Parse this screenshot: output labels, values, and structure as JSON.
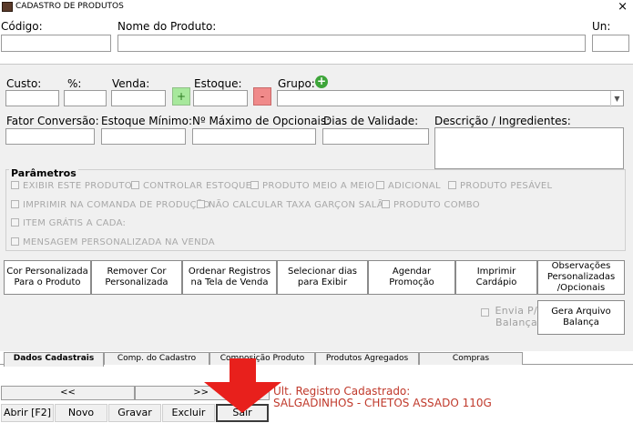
{
  "window": {
    "title": "CADASTRO DE PRODUTOS",
    "close_glyph": "×"
  },
  "top_fields": {
    "codigo_label": "Código:",
    "nome_label": "Nome do Produto:",
    "un_label": "Un:"
  },
  "row1": {
    "custo_label": "Custo:",
    "pct_label": "%:",
    "venda_label": "Venda:",
    "plus_glyph": "+",
    "estoque_label": "Estoque:",
    "minus_glyph": "-",
    "grupo_label": "Grupo:",
    "grupo_add_glyph": "+"
  },
  "row2": {
    "fator_label": "Fator Conversão:",
    "estoque_min_label": "Estoque Mínimo:",
    "max_opc_label": "Nº Máximo de Opcionais:",
    "validade_label": "Dias de Validade:",
    "descricao_label": "Descrição / Ingredientes:"
  },
  "parametros": {
    "title": "Parâmetros",
    "row1": [
      "EXIBIR ESTE PRODUTO",
      "CONTROLAR ESTOQUE",
      "PRODUTO MEIO A MEIO",
      "ADICIONAL",
      "PRODUTO PESÁVEL"
    ],
    "row2": [
      "IMPRIMIR NA COMANDA DE PRODUÇÃO",
      "NÃO CALCULAR TAXA GARÇON SALÃO",
      "PRODUTO COMBO"
    ],
    "row3": "ITEM GRÁTIS A CADA:",
    "row4": "MENSAGEM PERSONALIZADA NA VENDA"
  },
  "actions": {
    "cor_personalizada": "Cor Personalizada Para o Produto",
    "remover_cor": "Remover Cor Personalizada",
    "ordenar": "Ordenar Registros na Tela de Venda",
    "selecionar_dias": "Selecionar dias para  Exibir",
    "agendar": "Agendar Promoção",
    "imprimir_cardapio": "Imprimir Cardápio",
    "observacoes": "Observações Personalizadas /Opcionais",
    "envia_balanca": "Envia P/ Balança",
    "gera_arquivo": "Gera Arquivo Balança"
  },
  "tabs": [
    "Dados Cadastrais",
    "Comp. do Cadastro",
    "Composição Produto",
    "Produtos Agregados",
    "Compras"
  ],
  "nav": {
    "prev": "<<",
    "next": ">>"
  },
  "bottom_buttons": [
    "Abrir [F2]",
    "Novo",
    "Gravar",
    "Excluir",
    "Sair"
  ],
  "last_record": {
    "label": "Ult. Registro Cadastrado:",
    "value": "SALGADINHOS - CHETOS ASSADO 110G"
  },
  "colors": {
    "arrow": "#e8201c",
    "plus_button": "#a7e89c",
    "minus_button": "#f08a8a",
    "last_record_text": "#c0392b"
  }
}
